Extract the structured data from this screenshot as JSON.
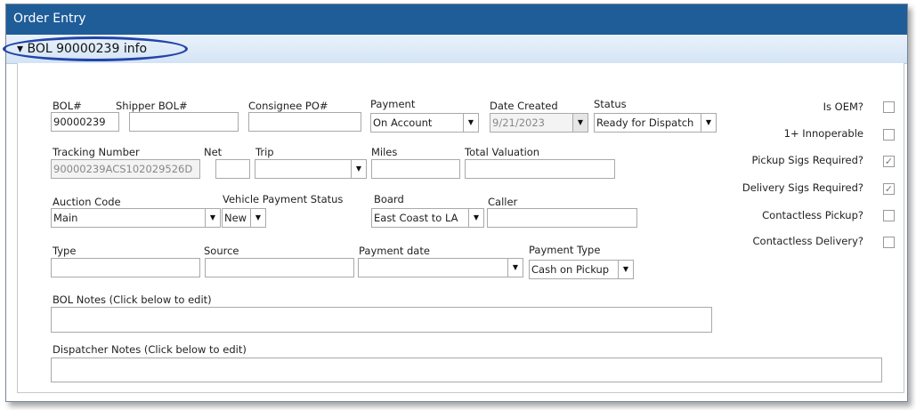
{
  "window": {
    "title": "Order Entry"
  },
  "section": {
    "toggle": "▾",
    "title": "BOL 90000239 info"
  },
  "fields": {
    "bol": {
      "label": "BOL#",
      "value": "90000239"
    },
    "shipper_bol": {
      "label": "Shipper BOL#",
      "value": ""
    },
    "consignee_po": {
      "label": "Consignee PO#",
      "value": ""
    },
    "payment": {
      "label": "Payment",
      "value": "On Account"
    },
    "date_created": {
      "label": "Date Created",
      "value": "9/21/2023"
    },
    "status": {
      "label": "Status",
      "value": "Ready for Dispatch"
    },
    "tracking_number": {
      "label": "Tracking Number",
      "value": "90000239ACS102029526D"
    },
    "net": {
      "label": "Net",
      "value": ""
    },
    "trip": {
      "label": "Trip",
      "value": ""
    },
    "miles": {
      "label": "Miles",
      "value": ""
    },
    "total_valuation": {
      "label": "Total Valuation",
      "value": ""
    },
    "auction_code": {
      "label": "Auction Code",
      "value": "Main"
    },
    "vehicle_payment_status": {
      "label": "Vehicle Payment Status",
      "value": "New"
    },
    "board": {
      "label": "Board",
      "value": "East Coast to LA"
    },
    "caller": {
      "label": "Caller",
      "value": ""
    },
    "type": {
      "label": "Type",
      "value": ""
    },
    "source": {
      "label": "Source",
      "value": ""
    },
    "payment_date": {
      "label": "Payment date",
      "value": ""
    },
    "payment_type": {
      "label": "Payment Type",
      "value": "Cash on Pickup"
    },
    "bol_notes": {
      "label": "BOL Notes (Click below to edit)",
      "value": ""
    },
    "dispatcher_notes": {
      "label": "Dispatcher Notes (Click below to edit)",
      "value": ""
    }
  },
  "checkboxes": [
    {
      "label": "Is OEM?",
      "checked": false
    },
    {
      "label": "1+ Innoperable",
      "checked": false
    },
    {
      "label": "Pickup Sigs Required?",
      "checked": true
    },
    {
      "label": "Delivery Sigs Required?",
      "checked": true
    },
    {
      "label": "Contactless Pickup?",
      "checked": false
    },
    {
      "label": "Contactless Delivery?",
      "checked": false
    }
  ],
  "icons": {
    "dropdown": "▼",
    "check": "✓"
  }
}
